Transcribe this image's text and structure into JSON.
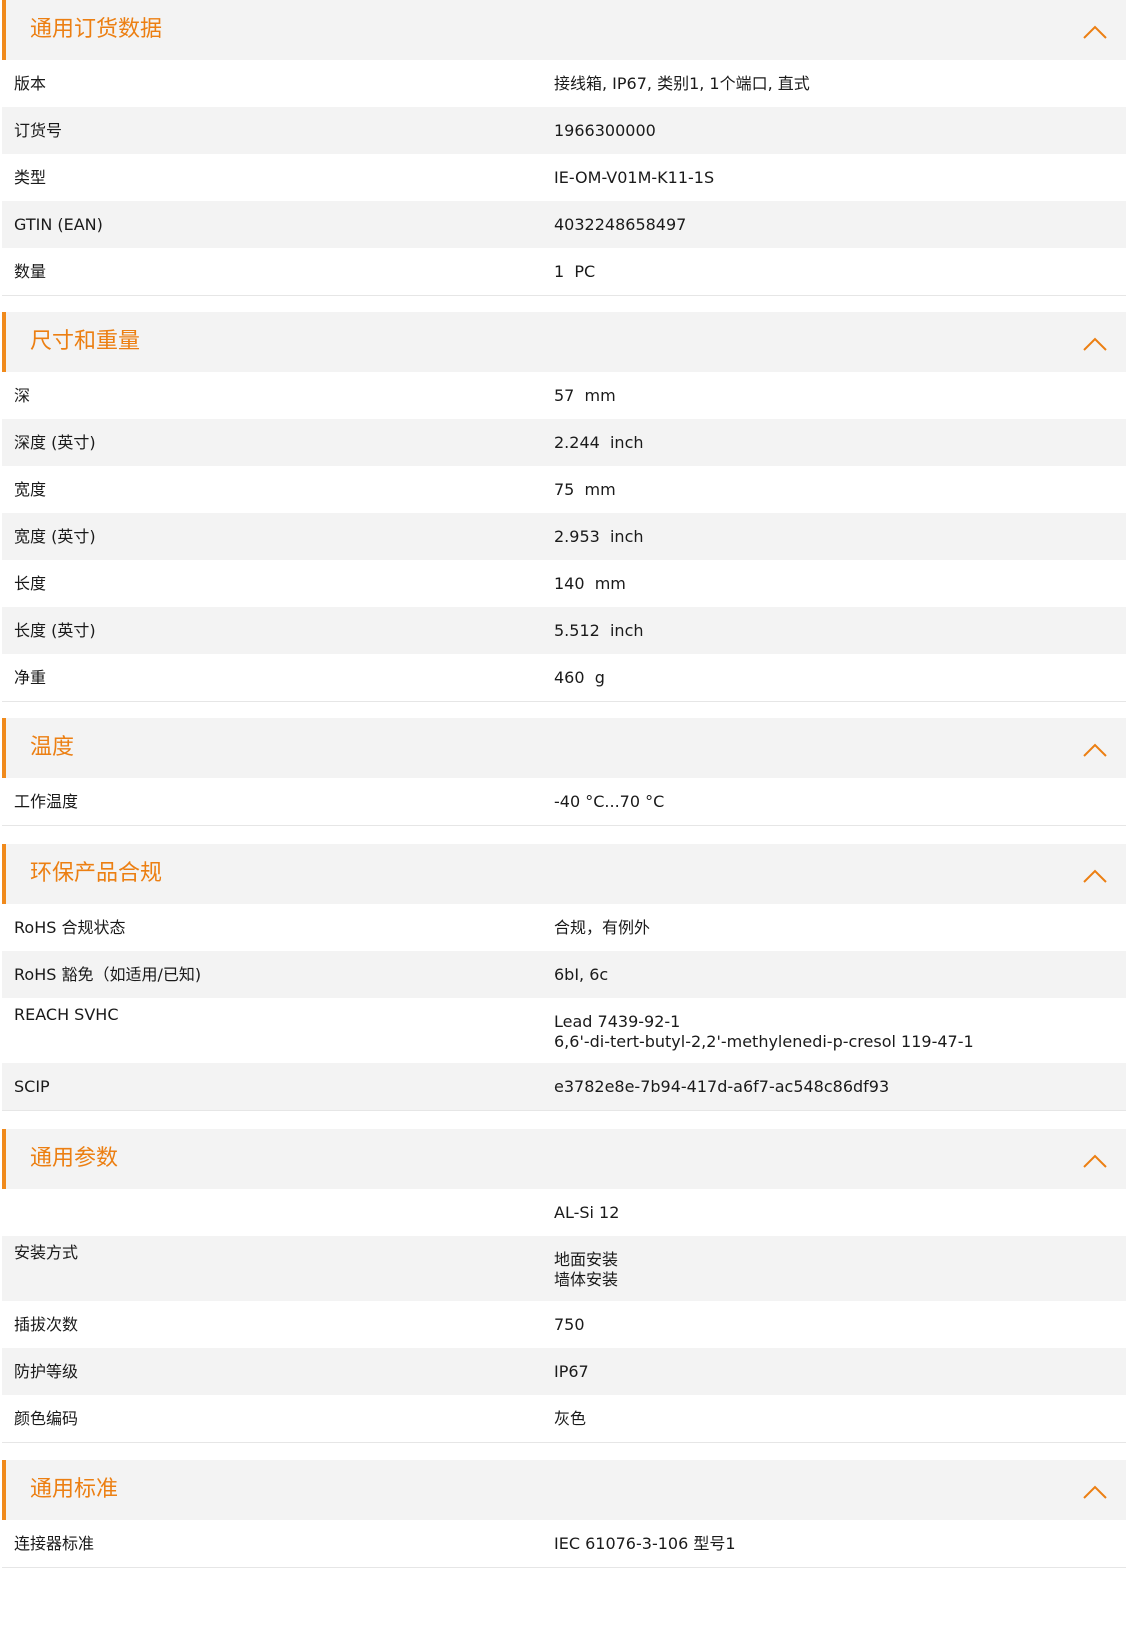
{
  "colors": {
    "accent": "#ec7f12",
    "header_bg": "#f3f3f3",
    "stripe_bg": "#f3f3f3",
    "text": "#1a1a1a"
  },
  "icons": {
    "collapse": "chevron-up-icon"
  },
  "sections": [
    {
      "title": "通用订货数据",
      "rows": [
        {
          "label": "版本",
          "value": "接线箱, IP67, 类别1, 1个端口, 直式"
        },
        {
          "label": "订货号",
          "value": "1966300000"
        },
        {
          "label": "类型",
          "value": "IE-OM-V01M-K11-1S"
        },
        {
          "label": "GTIN (EAN)",
          "value": "4032248658497"
        },
        {
          "label": "数量",
          "value": "1  PC"
        }
      ]
    },
    {
      "title": "尺寸和重量",
      "rows": [
        {
          "label": "深",
          "value": "57  mm"
        },
        {
          "label": "深度 (英寸)",
          "value": "2.244  inch"
        },
        {
          "label": "宽度",
          "value": "75  mm"
        },
        {
          "label": "宽度 (英寸)",
          "value": "2.953  inch"
        },
        {
          "label": "长度",
          "value": "140  mm"
        },
        {
          "label": "长度 (英寸)",
          "value": "5.512  inch"
        },
        {
          "label": "净重",
          "value": "460  g"
        }
      ]
    },
    {
      "title": "温度",
      "rows": [
        {
          "label": "工作温度",
          "value": "-40 °C...70 °C"
        }
      ]
    },
    {
      "title": "环保产品合规",
      "rows": [
        {
          "label": "RoHS 合规状态",
          "value": "合规，有例外"
        },
        {
          "label": "RoHS 豁免（如适用/已知)",
          "value": "6bI, 6c"
        },
        {
          "label": "REACH SVHC",
          "value": "Lead 7439-92-1\n6,6'-di-tert-butyl-2,2'-methylenedi-p-cresol 119-47-1"
        },
        {
          "label": "SCIP",
          "value": "e3782e8e-7b94-417d-a6f7-ac548c86df93"
        }
      ]
    },
    {
      "title": "通用参数",
      "rows": [
        {
          "label": "",
          "value": "AL-Si 12"
        },
        {
          "label": "安装方式",
          "value": "地面安装\n墙体安装"
        },
        {
          "label": "插拔次数",
          "value": "750"
        },
        {
          "label": "防护等级",
          "value": "IP67"
        },
        {
          "label": "颜色编码",
          "value": "灰色"
        }
      ]
    },
    {
      "title": "通用标准",
      "rows": [
        {
          "label": "连接器标准",
          "value": "IEC 61076-3-106 型号1"
        }
      ]
    }
  ]
}
